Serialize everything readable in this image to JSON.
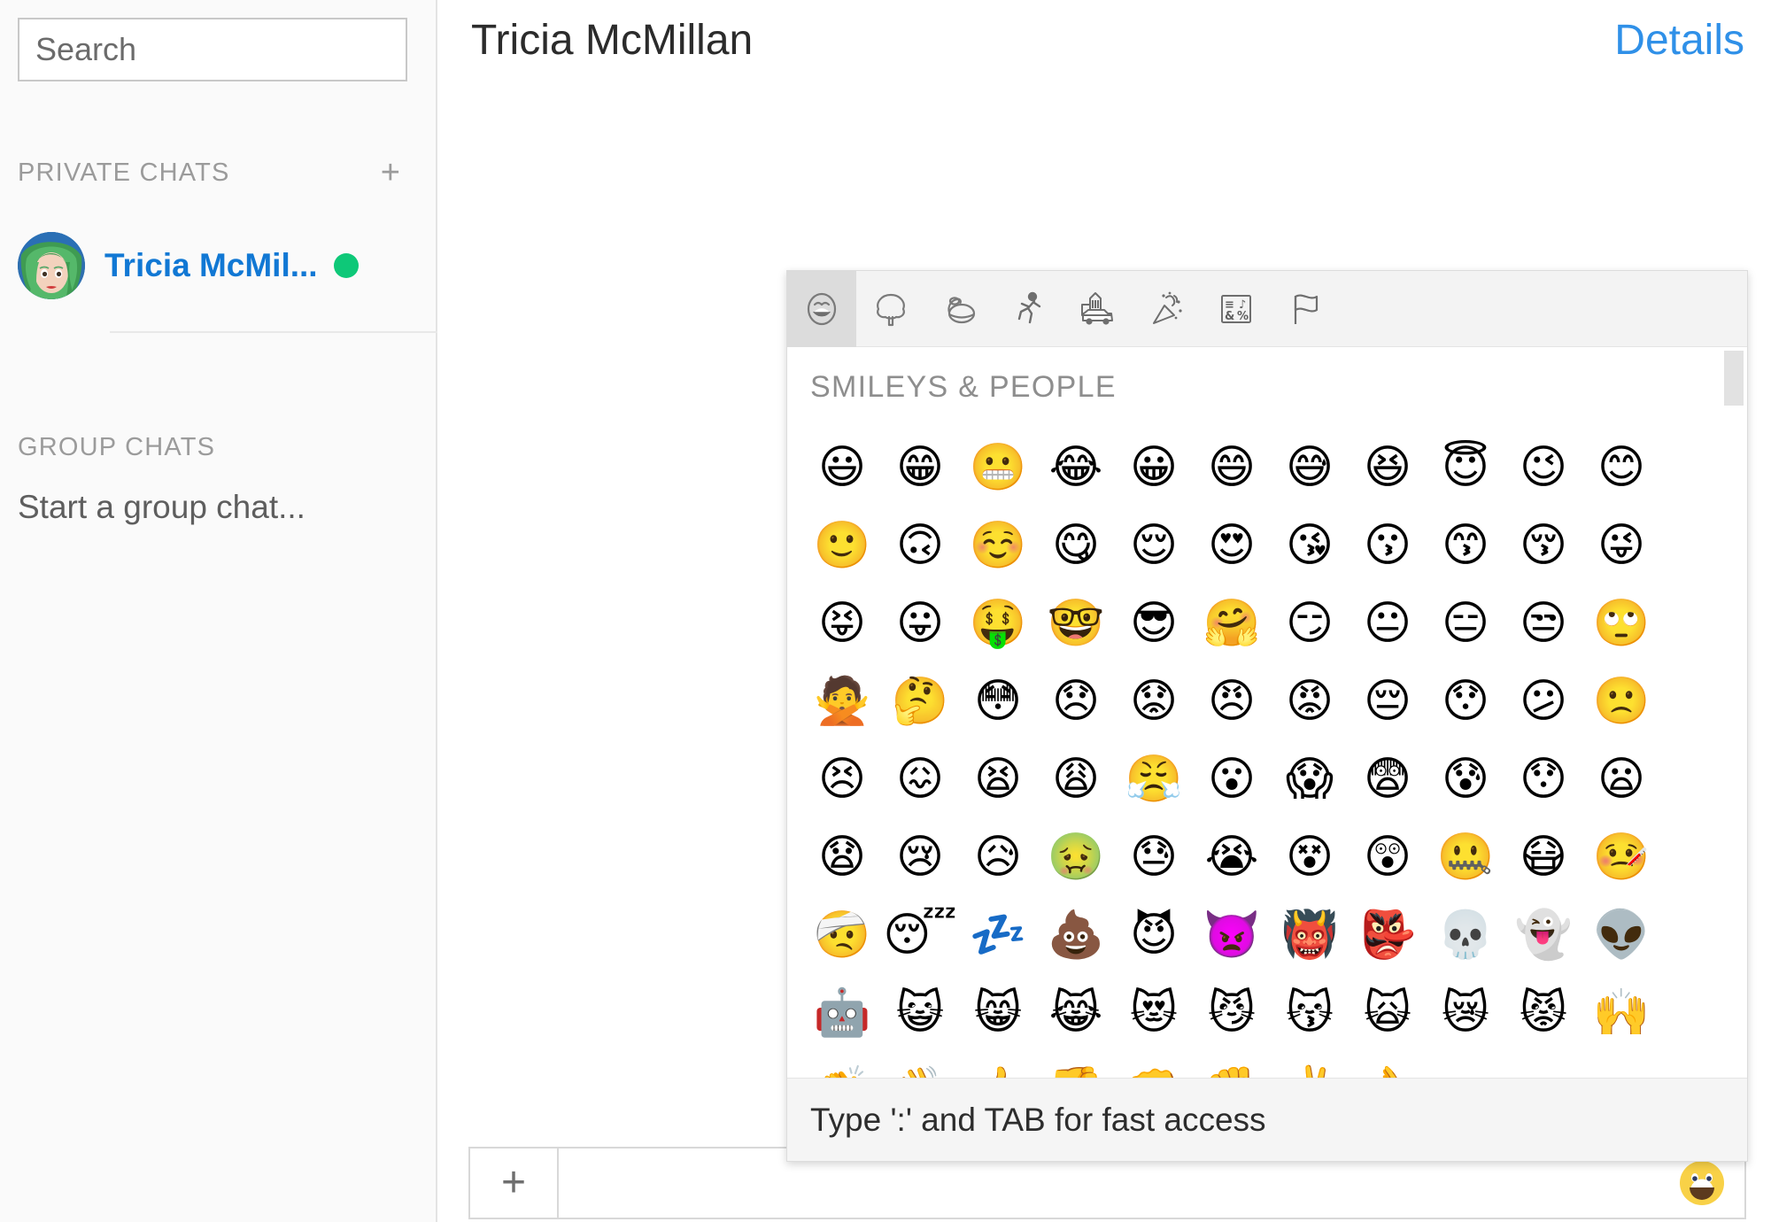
{
  "sidebar": {
    "search": {
      "placeholder": "Search",
      "value": ""
    },
    "private_chats": {
      "heading": "PRIVATE CHATS",
      "add_label": "+",
      "items": [
        {
          "name": "Tricia McMil...",
          "status": "online",
          "status_color": "#0ec878"
        }
      ]
    },
    "group_chats": {
      "heading": "GROUP CHATS",
      "empty_label": "Start a group chat..."
    }
  },
  "header": {
    "title": "Tricia McMillan",
    "details_label": "Details"
  },
  "composer": {
    "attach_label": "+",
    "placeholder": "",
    "value": "",
    "emoji_button_icon": "smiley-icon"
  },
  "emoji_picker": {
    "category_title": "SMILEYS & PEOPLE",
    "footer_hint": "Type ':' and TAB for fast access",
    "active_tab_index": 0,
    "tabs": [
      {
        "id": "smileys-people",
        "icon": "smiley-icon"
      },
      {
        "id": "animals-nature",
        "icon": "tree-icon"
      },
      {
        "id": "food-drink",
        "icon": "food-bowl-icon"
      },
      {
        "id": "activity",
        "icon": "runner-icon"
      },
      {
        "id": "travel-places",
        "icon": "car-building-icon"
      },
      {
        "id": "objects",
        "icon": "party-popper-icon"
      },
      {
        "id": "symbols",
        "icon": "symbols-icon"
      },
      {
        "id": "flags",
        "icon": "flag-icon"
      }
    ],
    "columns": 12,
    "emojis": [
      "😃",
      "😁",
      "😬",
      "😂",
      "😀",
      "😄",
      "😅",
      "😆",
      "😇",
      "😉",
      "😊",
      "🙂",
      "🙃",
      "☺️",
      "😋",
      "😌",
      "😍",
      "😘",
      "😗",
      "😙",
      "😚",
      "😜",
      "😝",
      "😛",
      "🤑",
      "🤓",
      "😎",
      "🤗",
      "😏",
      "😐",
      "😑",
      "😒",
      "🙄",
      "🙅",
      "🤔",
      "😳",
      "😞",
      "😟",
      "😠",
      "😡",
      "😔",
      "😯",
      "😕",
      "🙁",
      "😣",
      "😖",
      "😫",
      "😩",
      "😤",
      "😮",
      "😱",
      "😨",
      "😰",
      "😯",
      "😦",
      "😧",
      "😢",
      "😥",
      "🤢",
      "😓",
      "😭",
      "😵",
      "😲",
      "🤐",
      "😷",
      "🤒",
      "🤕",
      "😴",
      "💤",
      "💩",
      "😈",
      "👿",
      "👹",
      "👺",
      "💀",
      "👻",
      "👽",
      "🤖",
      "😺",
      "😸",
      "😹",
      "😻",
      "😼",
      "😽",
      "🙀",
      "😿",
      "😾",
      "🙌",
      "👏",
      "👋",
      "👍",
      "👎",
      "👊",
      "✊",
      "✌️",
      "👌"
    ]
  }
}
